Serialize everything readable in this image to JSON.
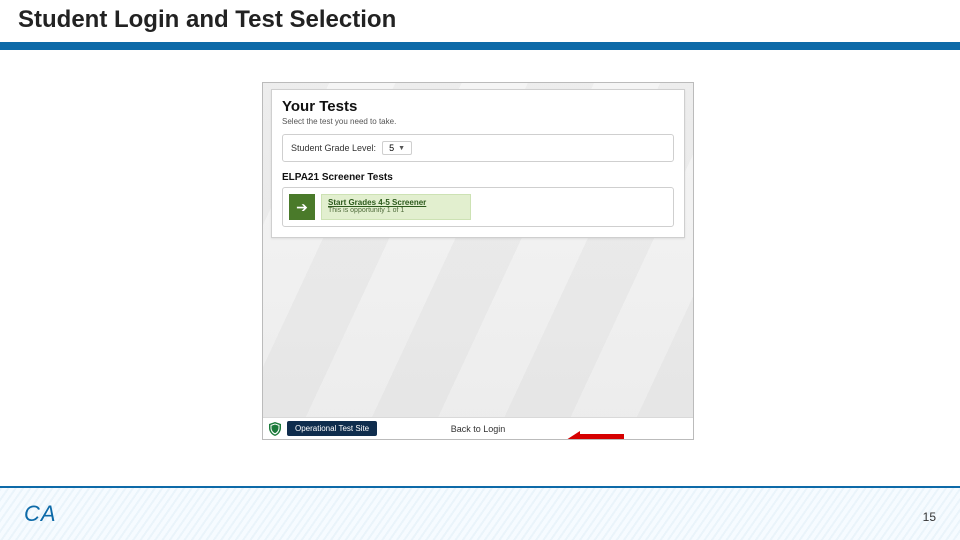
{
  "slide": {
    "title": "Student Login and Test Selection",
    "page_number": "15",
    "logo_text": "CA"
  },
  "app": {
    "card_title": "Your Tests",
    "card_subtitle": "Select the test you need to take.",
    "grade_label": "Student Grade Level:",
    "grade_value": "5",
    "section_title": "ELPA21 Screener Tests",
    "test": {
      "link_text": "Start Grades 4-5 Screener",
      "meta_text": "This is opportunity 1 of 1"
    },
    "footer": {
      "site_label": "Operational Test Site",
      "back_label": "Back to Login"
    }
  }
}
